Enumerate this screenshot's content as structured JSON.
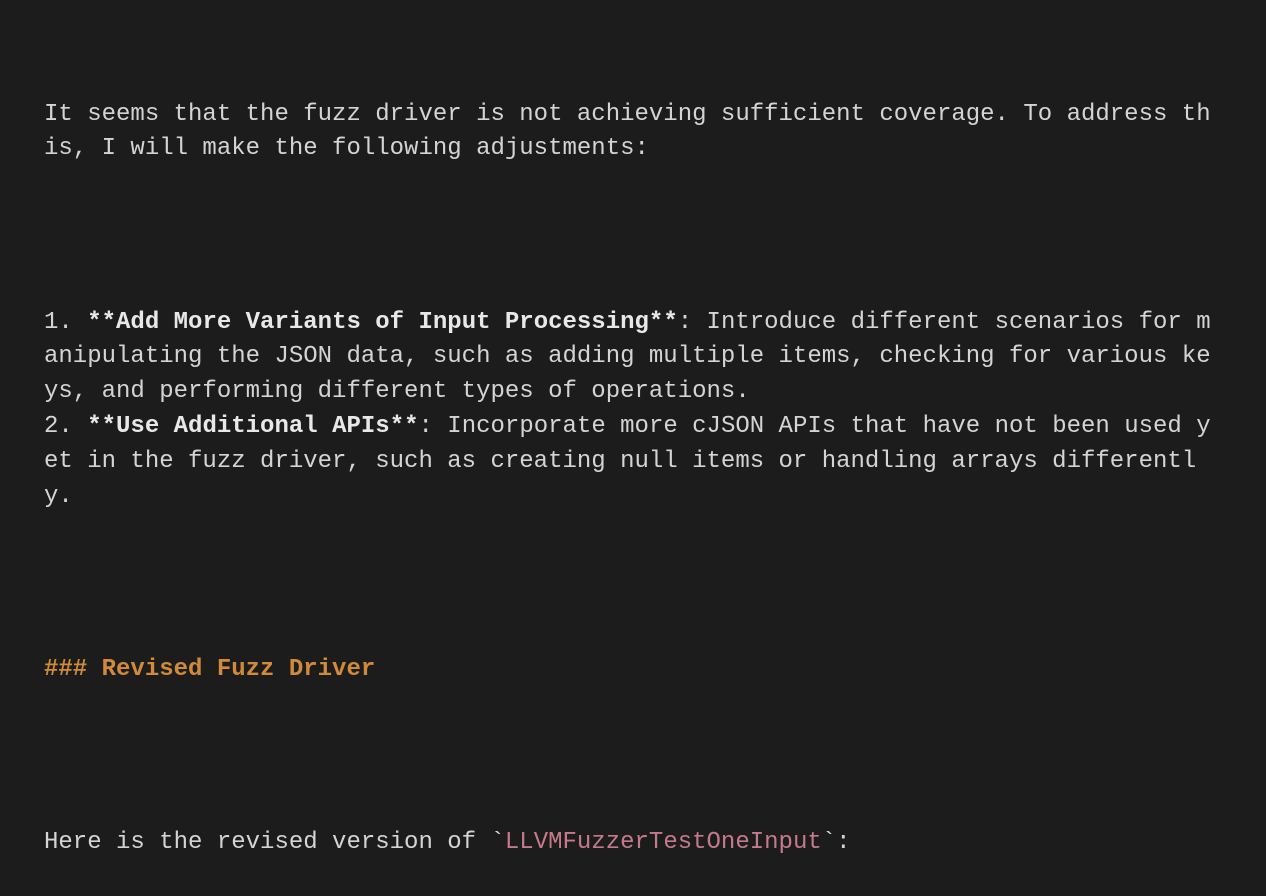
{
  "intro": "It seems that the fuzz driver is not achieving sufficient coverage. To address this, I will make the following adjustments:",
  "list": {
    "item1": {
      "num": "1. ",
      "boldMarkerOpen": "**",
      "boldText": "Add More Variants of Input Processing",
      "boldMarkerClose": "**",
      "rest": ": Introduce different scenarios for manipulating the JSON data, such as adding multiple items, checking for various keys, and performing different types of operations."
    },
    "item2": {
      "num": "2. ",
      "boldMarkerOpen": "**",
      "boldText": "Use Additional APIs",
      "boldMarkerClose": "**",
      "rest": ": Incorporate more cJSON APIs that have not been used yet in the fuzz driver, such as creating null items or handling arrays differently."
    }
  },
  "heading": {
    "marker": "### ",
    "text": "Revised Fuzz Driver"
  },
  "outro": {
    "prefix": "Here is the revised version of ",
    "tickOpen": "`",
    "code": "LLVMFuzzerTestOneInput",
    "tickClose": "`",
    "suffix": ":"
  }
}
